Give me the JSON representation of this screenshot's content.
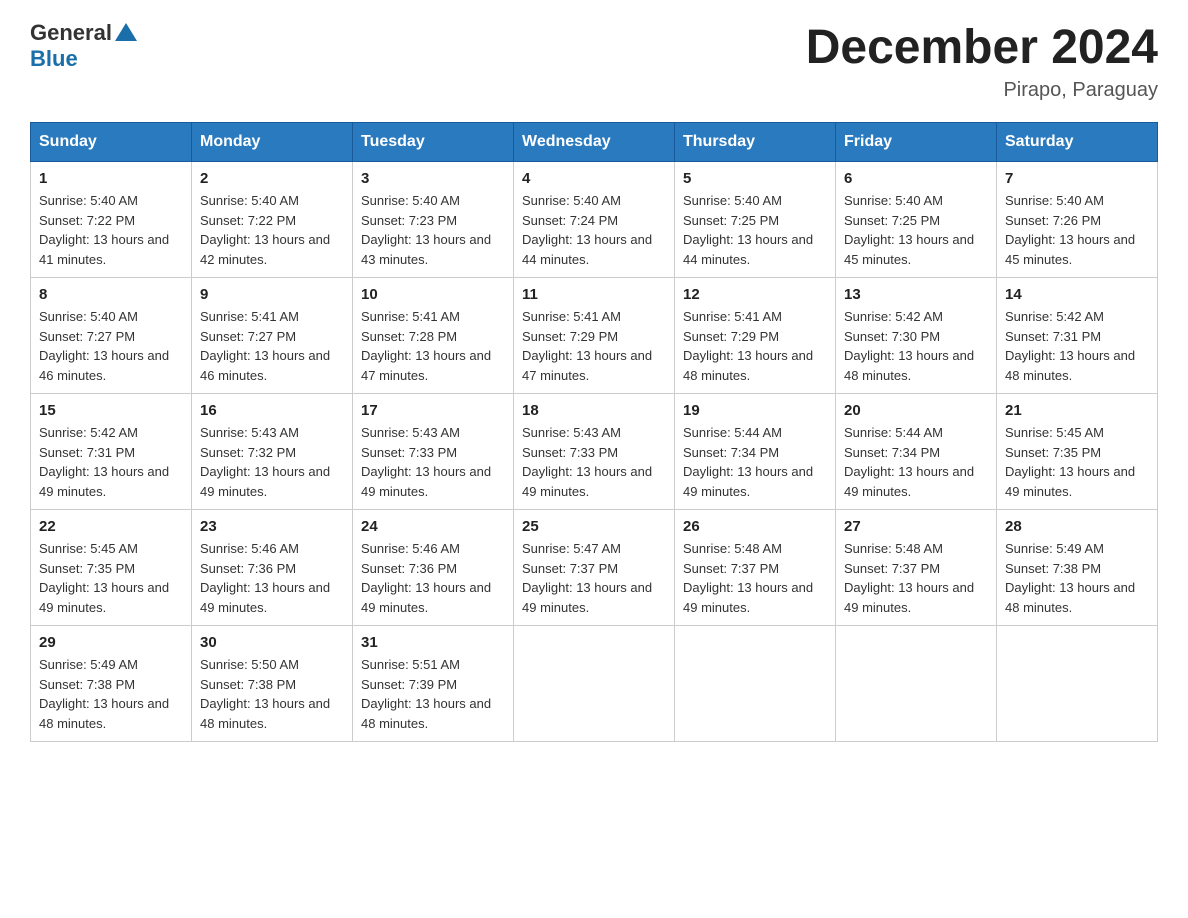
{
  "header": {
    "logo_text_general": "General",
    "logo_text_blue": "Blue",
    "page_title": "December 2024",
    "subtitle": "Pirapo, Paraguay"
  },
  "days_of_week": [
    "Sunday",
    "Monday",
    "Tuesday",
    "Wednesday",
    "Thursday",
    "Friday",
    "Saturday"
  ],
  "weeks": [
    [
      {
        "day": "1",
        "sunrise": "5:40 AM",
        "sunset": "7:22 PM",
        "daylight": "13 hours and 41 minutes."
      },
      {
        "day": "2",
        "sunrise": "5:40 AM",
        "sunset": "7:22 PM",
        "daylight": "13 hours and 42 minutes."
      },
      {
        "day": "3",
        "sunrise": "5:40 AM",
        "sunset": "7:23 PM",
        "daylight": "13 hours and 43 minutes."
      },
      {
        "day": "4",
        "sunrise": "5:40 AM",
        "sunset": "7:24 PM",
        "daylight": "13 hours and 44 minutes."
      },
      {
        "day": "5",
        "sunrise": "5:40 AM",
        "sunset": "7:25 PM",
        "daylight": "13 hours and 44 minutes."
      },
      {
        "day": "6",
        "sunrise": "5:40 AM",
        "sunset": "7:25 PM",
        "daylight": "13 hours and 45 minutes."
      },
      {
        "day": "7",
        "sunrise": "5:40 AM",
        "sunset": "7:26 PM",
        "daylight": "13 hours and 45 minutes."
      }
    ],
    [
      {
        "day": "8",
        "sunrise": "5:40 AM",
        "sunset": "7:27 PM",
        "daylight": "13 hours and 46 minutes."
      },
      {
        "day": "9",
        "sunrise": "5:41 AM",
        "sunset": "7:27 PM",
        "daylight": "13 hours and 46 minutes."
      },
      {
        "day": "10",
        "sunrise": "5:41 AM",
        "sunset": "7:28 PM",
        "daylight": "13 hours and 47 minutes."
      },
      {
        "day": "11",
        "sunrise": "5:41 AM",
        "sunset": "7:29 PM",
        "daylight": "13 hours and 47 minutes."
      },
      {
        "day": "12",
        "sunrise": "5:41 AM",
        "sunset": "7:29 PM",
        "daylight": "13 hours and 48 minutes."
      },
      {
        "day": "13",
        "sunrise": "5:42 AM",
        "sunset": "7:30 PM",
        "daylight": "13 hours and 48 minutes."
      },
      {
        "day": "14",
        "sunrise": "5:42 AM",
        "sunset": "7:31 PM",
        "daylight": "13 hours and 48 minutes."
      }
    ],
    [
      {
        "day": "15",
        "sunrise": "5:42 AM",
        "sunset": "7:31 PM",
        "daylight": "13 hours and 49 minutes."
      },
      {
        "day": "16",
        "sunrise": "5:43 AM",
        "sunset": "7:32 PM",
        "daylight": "13 hours and 49 minutes."
      },
      {
        "day": "17",
        "sunrise": "5:43 AM",
        "sunset": "7:33 PM",
        "daylight": "13 hours and 49 minutes."
      },
      {
        "day": "18",
        "sunrise": "5:43 AM",
        "sunset": "7:33 PM",
        "daylight": "13 hours and 49 minutes."
      },
      {
        "day": "19",
        "sunrise": "5:44 AM",
        "sunset": "7:34 PM",
        "daylight": "13 hours and 49 minutes."
      },
      {
        "day": "20",
        "sunrise": "5:44 AM",
        "sunset": "7:34 PM",
        "daylight": "13 hours and 49 minutes."
      },
      {
        "day": "21",
        "sunrise": "5:45 AM",
        "sunset": "7:35 PM",
        "daylight": "13 hours and 49 minutes."
      }
    ],
    [
      {
        "day": "22",
        "sunrise": "5:45 AM",
        "sunset": "7:35 PM",
        "daylight": "13 hours and 49 minutes."
      },
      {
        "day": "23",
        "sunrise": "5:46 AM",
        "sunset": "7:36 PM",
        "daylight": "13 hours and 49 minutes."
      },
      {
        "day": "24",
        "sunrise": "5:46 AM",
        "sunset": "7:36 PM",
        "daylight": "13 hours and 49 minutes."
      },
      {
        "day": "25",
        "sunrise": "5:47 AM",
        "sunset": "7:37 PM",
        "daylight": "13 hours and 49 minutes."
      },
      {
        "day": "26",
        "sunrise": "5:48 AM",
        "sunset": "7:37 PM",
        "daylight": "13 hours and 49 minutes."
      },
      {
        "day": "27",
        "sunrise": "5:48 AM",
        "sunset": "7:37 PM",
        "daylight": "13 hours and 49 minutes."
      },
      {
        "day": "28",
        "sunrise": "5:49 AM",
        "sunset": "7:38 PM",
        "daylight": "13 hours and 48 minutes."
      }
    ],
    [
      {
        "day": "29",
        "sunrise": "5:49 AM",
        "sunset": "7:38 PM",
        "daylight": "13 hours and 48 minutes."
      },
      {
        "day": "30",
        "sunrise": "5:50 AM",
        "sunset": "7:38 PM",
        "daylight": "13 hours and 48 minutes."
      },
      {
        "day": "31",
        "sunrise": "5:51 AM",
        "sunset": "7:39 PM",
        "daylight": "13 hours and 48 minutes."
      },
      {
        "day": "",
        "sunrise": "",
        "sunset": "",
        "daylight": ""
      },
      {
        "day": "",
        "sunrise": "",
        "sunset": "",
        "daylight": ""
      },
      {
        "day": "",
        "sunrise": "",
        "sunset": "",
        "daylight": ""
      },
      {
        "day": "",
        "sunrise": "",
        "sunset": "",
        "daylight": ""
      }
    ]
  ]
}
